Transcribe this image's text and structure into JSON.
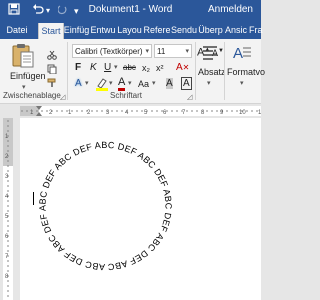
{
  "titlebar": {
    "title": "Dokument1 - Word",
    "account": "Anmelden",
    "save_icon": "save-icon",
    "undo_icon": "undo-icon",
    "redo_icon": "redo-icon",
    "customize_icon": "customize-icon"
  },
  "tabs": [
    "Datei",
    "Start",
    "Einfüg",
    "Entwu",
    "Layou",
    "Refere",
    "Sendu",
    "Überp",
    "Ansic",
    "Frag"
  ],
  "ribbon": {
    "paste_label": "Einfügen",
    "font_name": "Calibri (Textkörper)",
    "font_size": "11",
    "bold": "F",
    "italic": "K",
    "underline": "U",
    "strikethrough": "abc",
    "subscript": "x₂",
    "superscript": "x²",
    "grow_font": "A",
    "shrink_font": "A",
    "change_case": "Aa",
    "highlight_color": "#ffff00",
    "font_color": "#c00000",
    "clear_format_label": "A",
    "text_effects_label": "A",
    "aa_label": "Aa",
    "paragraph_label": "Absatz",
    "styles_label": "Formatvo",
    "clipboard_group": "Zwischenablage",
    "font_group": "Schriftart"
  },
  "ruler": {
    "h_numbers": [
      "1",
      "2",
      "1",
      "2",
      "3",
      "4",
      "5",
      "6",
      "7",
      "8",
      "9",
      "10",
      "11"
    ],
    "v_numbers": [
      "1",
      "2",
      "3",
      "4",
      "5",
      "6",
      "7",
      "8"
    ]
  },
  "document": {
    "circle_text": "ABC DEF ABC DEF ABC DEF ABC DEF ABC DEF ABC DEF ABC DEF ABC DEF ABC DEF ABC DEF ABC DEF ABC DEF"
  }
}
